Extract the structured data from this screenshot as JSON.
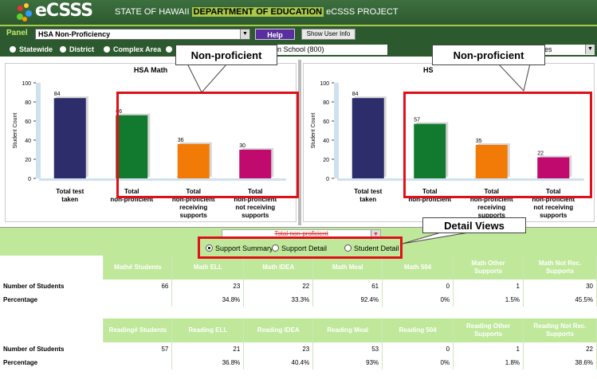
{
  "app": {
    "logo": "eCSSS",
    "title_prefix": "STATE OF HAWAII",
    "title_dept": "DEPARTMENT OF EDUCATION",
    "title_suffix": "eCSSS PROJECT"
  },
  "panel": {
    "label": "Panel",
    "selected": "HSA Non-Proficiency",
    "help_label": "Help",
    "show_user_info_label": "Show User Info"
  },
  "scope": {
    "options": [
      "Statewide",
      "District",
      "Complex Area"
    ],
    "school": "n School (800)",
    "grades": "des"
  },
  "callouts": {
    "left": "Non-proficient",
    "right": "Non-proficient",
    "detail": "Detail Views"
  },
  "chart_data": [
    {
      "type": "bar",
      "title": "HSA Math",
      "ylabel": "Student Count",
      "ylim": [
        0,
        100
      ],
      "yticks": [
        0,
        20,
        40,
        60,
        80,
        100
      ],
      "categories": [
        "Total test taken",
        "Total non-proficient",
        "Total non-proficient receiving supports",
        "Total non-proficient not receiving supports"
      ],
      "values": [
        84,
        66,
        36,
        30
      ],
      "colors": [
        "#2e2d6b",
        "#117a2e",
        "#f27a07",
        "#c00a6e"
      ]
    },
    {
      "type": "bar",
      "title": "HS",
      "ylabel": "Student Count",
      "ylim": [
        0,
        100
      ],
      "yticks": [
        0,
        20,
        40,
        60,
        80,
        100
      ],
      "categories": [
        "Total test taken",
        "Total non-proficient",
        "Total non-proficient receiving supports",
        "Total non-proficient not receiving supports"
      ],
      "values": [
        84,
        57,
        35,
        22
      ],
      "colors": [
        "#2e2d6b",
        "#117a2e",
        "#f27a07",
        "#c00a6e"
      ]
    }
  ],
  "filter": {
    "selected": "Total non-proficient"
  },
  "detail_views": {
    "options": [
      "Support Summary",
      "Support Detail",
      "Student Detail"
    ],
    "selected": "Support Summary"
  },
  "math_table": {
    "headers": [
      "Math# Students",
      "Math ELL",
      "Math IDEA",
      "Math Meal",
      "Math 504",
      "Math Other Supports",
      "Math Not Rec. Supports"
    ],
    "rows": [
      {
        "label": "Number of Students",
        "values": [
          "66",
          "23",
          "22",
          "61",
          "0",
          "1",
          "30"
        ]
      },
      {
        "label": "Percentage",
        "values": [
          "",
          "34.8%",
          "33.3%",
          "92.4%",
          "0%",
          "1.5%",
          "45.5%"
        ]
      }
    ]
  },
  "reading_table": {
    "headers": [
      "Reading# Students",
      "Reading ELL",
      "Reading IDEA",
      "Reading Meal",
      "Reading 504",
      "Reading Other Supports",
      "Reading Not Rec. Supports"
    ],
    "rows": [
      {
        "label": "Number of Students",
        "values": [
          "57",
          "21",
          "23",
          "53",
          "0",
          "1",
          "22"
        ]
      },
      {
        "label": "Percentage",
        "values": [
          "",
          "36.8%",
          "40.4%",
          "93%",
          "0%",
          "1.8%",
          "38.6%"
        ]
      }
    ]
  }
}
